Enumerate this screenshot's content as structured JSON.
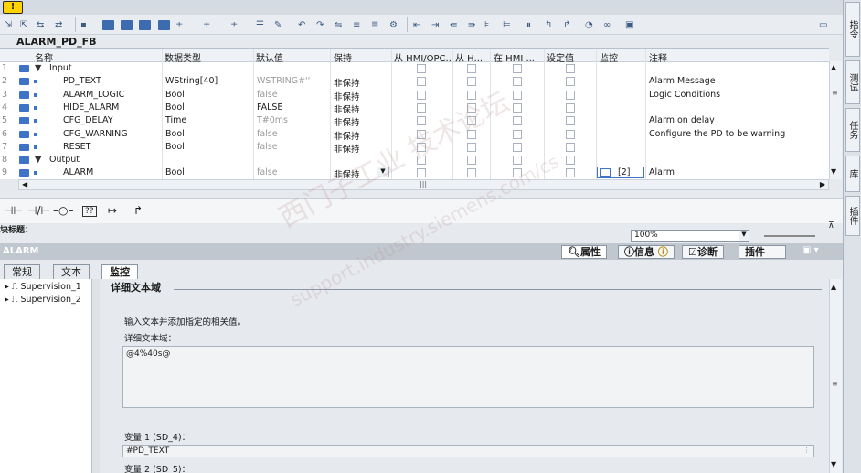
{
  "block_title": "ALARM_PD_FB",
  "warning_icon": "!",
  "columns": [
    "名称",
    "数据类型",
    "默认值",
    "保持",
    "从 HMI/OPC...",
    "从 H...",
    "在 HMI ...",
    "设定值",
    "监控",
    "注释"
  ],
  "rows": [
    {
      "num": "1",
      "name": "Input",
      "type": "",
      "default": "",
      "retain": "",
      "comment": "",
      "expander": "▼"
    },
    {
      "num": "2",
      "name": "PD_TEXT",
      "type": "WString[40]",
      "default": "WSTRING#''",
      "retain": "非保持",
      "comment": "Alarm Message"
    },
    {
      "num": "3",
      "name": "ALARM_LOGIC",
      "type": "Bool",
      "default": "false",
      "retain": "非保持",
      "comment": "Logic Conditions"
    },
    {
      "num": "4",
      "name": "HIDE_ALARM",
      "type": "Bool",
      "default": "FALSE",
      "retain": "非保持",
      "comment": ""
    },
    {
      "num": "5",
      "name": "CFG_DELAY",
      "type": "Time",
      "default": "T#0ms",
      "retain": "非保持",
      "comment": "Alarm on delay"
    },
    {
      "num": "6",
      "name": "CFG_WARNING",
      "type": "Bool",
      "default": "false",
      "retain": "非保持",
      "comment": "Configure the PD to be warning"
    },
    {
      "num": "7",
      "name": "RESET",
      "type": "Bool",
      "default": "false",
      "retain": "非保持",
      "comment": ""
    },
    {
      "num": "8",
      "name": "Output",
      "type": "",
      "default": "",
      "retain": "",
      "comment": "",
      "expander": "▼"
    },
    {
      "num": "9",
      "name": "ALARM",
      "type": "Bool",
      "default": "false",
      "retain": "非保持",
      "supervision": "[2]",
      "comment": "Alarm"
    }
  ],
  "ladder_symbols": [
    "⊣⊢",
    "⊣/⊢",
    "–○–",
    "??",
    "↦",
    "↱"
  ],
  "network_label": "块标题：",
  "zoom": "100%",
  "inspector": {
    "title": "ALARM",
    "tabs_right": [
      "属性",
      "信息",
      "诊断",
      "插件"
    ],
    "subtabs": [
      "常规",
      "文本",
      "监控"
    ],
    "tree": [
      "Supervision_1",
      "Supervision_2"
    ],
    "section": "详细文本域",
    "prompt": "输入文本并添加指定的相关值。",
    "field_label": "详细文本域：",
    "text_value": "@4%40s@",
    "var1_label": "变量 1 (SD_4)：",
    "var1_value": "#PD_TEXT",
    "var2_label": "变量 2 (SD_5)："
  },
  "side_tabs": [
    "指令",
    "测试",
    "任务",
    "库",
    "插件"
  ],
  "watermark": "西门子工业 技术论坛",
  "watermark2": "support.industry.siemens.com/cs"
}
